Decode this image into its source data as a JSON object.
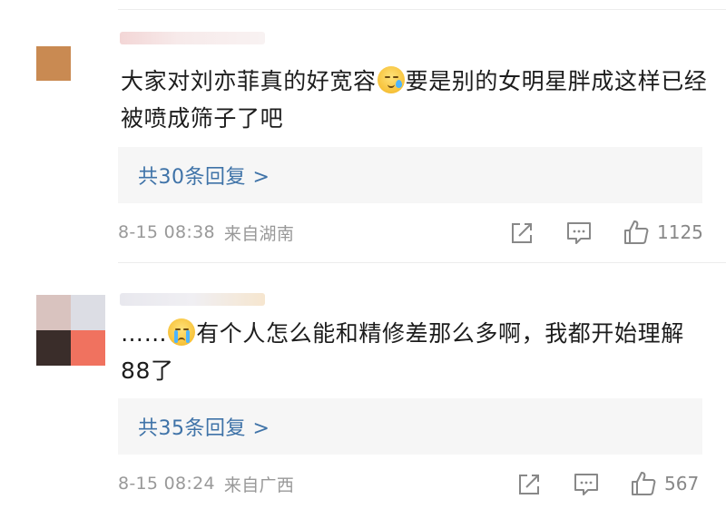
{
  "comments": [
    {
      "text_before": "大家对刘亦菲真的好宽容",
      "emoji": "sweat-smile-emoji",
      "text_after": "要是别的女明星胖成这样已经被喷成筛子了吧",
      "replies": "共30条回复 >",
      "date": "8-15 08:38",
      "location": "来自湖南",
      "likes": "1125"
    },
    {
      "text_before": "……",
      "emoji": "crying-emoji",
      "text_after": "有个人怎么能和精修差那么多啊，我都开始理解88了",
      "replies": "共35条回复 >",
      "date": "8-15 08:24",
      "location": "来自广西",
      "likes": "567"
    }
  ],
  "colors": {
    "reply_link": "#3f73a8",
    "meta_text": "#999999",
    "reply_bg": "#f6f6f6"
  },
  "icons": [
    "share-icon",
    "comment-icon",
    "like-icon"
  ]
}
